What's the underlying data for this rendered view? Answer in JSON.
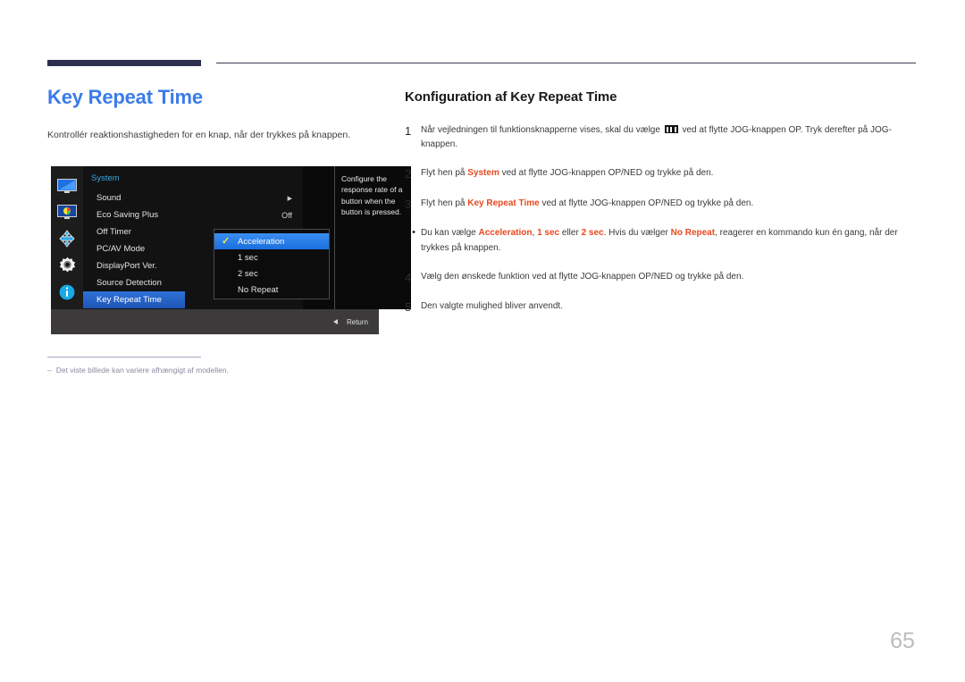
{
  "document": {
    "page_number": "65"
  },
  "left": {
    "title": "Key Repeat Time",
    "description": "Kontrollér reaktionshastigheden for en knap, når der trykkes på knappen.",
    "footnote_dash": "‒",
    "footnote": "Det viste billede kan variere afhængigt af modellen."
  },
  "osd": {
    "group_label": "System",
    "sidebar_icons": [
      "monitor-icon",
      "picture-icon",
      "onscreen-display-icon",
      "system-gear-icon",
      "information-icon"
    ],
    "rows": [
      {
        "label": "Sound",
        "value": "",
        "arrow": "▶",
        "selected": false
      },
      {
        "label": "Eco Saving Plus",
        "value": "Off",
        "arrow": "",
        "selected": false
      },
      {
        "label": "Off Timer",
        "value": "",
        "arrow": "",
        "selected": false
      },
      {
        "label": "PC/AV Mode",
        "value": "",
        "arrow": "",
        "selected": false
      },
      {
        "label": "DisplayPort Ver.",
        "value": "",
        "arrow": "",
        "selected": false
      },
      {
        "label": "Source Detection",
        "value": "",
        "arrow": "",
        "selected": false
      },
      {
        "label": "Key Repeat Time",
        "value": "",
        "arrow": "",
        "selected": true
      }
    ],
    "submenu": [
      {
        "label": "Acceleration",
        "checked": true
      },
      {
        "label": "1 sec",
        "checked": false
      },
      {
        "label": "2 sec",
        "checked": false
      },
      {
        "label": "No Repeat",
        "checked": false
      }
    ],
    "check_glyph": "✓",
    "description": "Configure the response rate of a button when the button is pressed.",
    "return_label": "Return"
  },
  "right": {
    "section_title": "Konfiguration af Key Repeat Time",
    "steps": [
      {
        "marker": "1",
        "type": "num",
        "parts": [
          {
            "t": "Når vejledningen til funktionsknapperne vises, skal du vælge ",
            "hl": false
          },
          {
            "t": "MENU-GLYPH",
            "hl": false,
            "glyph": true
          },
          {
            "t": " ved at flytte JOG-knappen OP. Tryk derefter på JOG-knappen.",
            "hl": false
          }
        ]
      },
      {
        "marker": "2",
        "type": "num",
        "parts": [
          {
            "t": "Flyt hen på ",
            "hl": false
          },
          {
            "t": "System",
            "hl": true
          },
          {
            "t": " ved at flytte JOG-knappen OP/NED og trykke på den.",
            "hl": false
          }
        ]
      },
      {
        "marker": "3",
        "type": "num",
        "parts": [
          {
            "t": "Flyt hen på ",
            "hl": false
          },
          {
            "t": "Key Repeat Time",
            "hl": true
          },
          {
            "t": " ved at flytte JOG-knappen OP/NED og trykke på den.",
            "hl": false
          }
        ]
      },
      {
        "marker": "•",
        "type": "bullet",
        "parts": [
          {
            "t": "Du kan vælge ",
            "hl": false
          },
          {
            "t": "Acceleration",
            "hl": true
          },
          {
            "t": ", ",
            "hl": false
          },
          {
            "t": "1 sec",
            "hl": true
          },
          {
            "t": " eller ",
            "hl": false
          },
          {
            "t": "2 sec",
            "hl": true
          },
          {
            "t": ". Hvis du vælger ",
            "hl": false
          },
          {
            "t": "No Repeat",
            "hl": true
          },
          {
            "t": ", reagerer en kommando kun én gang, når der trykkes på knappen.",
            "hl": false
          }
        ]
      },
      {
        "marker": "4",
        "type": "num",
        "parts": [
          {
            "t": "Vælg den ønskede funktion ved at flytte JOG-knappen OP/NED og trykke på den.",
            "hl": false
          }
        ]
      },
      {
        "marker": "5",
        "type": "num",
        "parts": [
          {
            "t": "Den valgte mulighed bliver anvendt.",
            "hl": false
          }
        ]
      }
    ]
  },
  "colors": {
    "title_blue": "#3a7bea",
    "rule_navy": "#2e2e4f",
    "highlight_orange": "#e8491f",
    "osd_select_blue": "#2f72d8",
    "osd_group_cyan": "#39a8dd",
    "check_yellow": "#ffe13d"
  }
}
